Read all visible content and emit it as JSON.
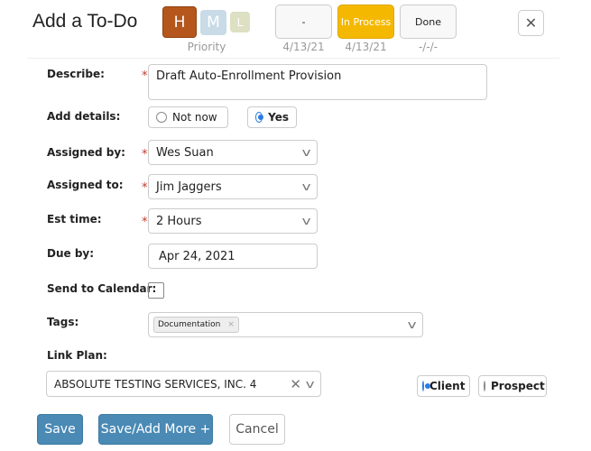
{
  "header": {
    "title": "Add a To-Do",
    "priority_label": "Priority",
    "priorities": [
      {
        "label": "H",
        "color": "#b5571c",
        "selected": true
      },
      {
        "label": "M",
        "color": "#c8dbe6"
      },
      {
        "label": "L",
        "color": "#dde0c2"
      }
    ],
    "statuses": [
      {
        "label": "-",
        "date": "4/13/21"
      },
      {
        "label": "In Process",
        "date": "4/13/21",
        "color": "#f5b800",
        "selected": true
      },
      {
        "label": "Done",
        "date": "-/-/-"
      }
    ],
    "close": "✕"
  },
  "form": {
    "describe": {
      "label": "Describe:",
      "value": "Draft Auto-Enrollment Provision"
    },
    "add_details": {
      "label": "Add details:",
      "options": [
        "Not now",
        "Yes"
      ],
      "selected": "Yes"
    },
    "assigned_by": {
      "label": "Assigned by:",
      "value": "Wes Suan"
    },
    "assigned_to": {
      "label": "Assigned to:",
      "value": "Jim Jaggers"
    },
    "est_time": {
      "label": "Est time:",
      "value": "2 Hours"
    },
    "due_by": {
      "label": "Due by:",
      "value": "Apr 24, 2021"
    },
    "send_to_calendar": {
      "label": "Send to Calendar:",
      "checked": false
    },
    "tags": {
      "label": "Tags:",
      "values": [
        "Documentation"
      ]
    },
    "link_plan": {
      "label": "Link Plan:",
      "value": "ABSOLUTE TESTING SERVICES, INC. 4",
      "options": [
        "Client",
        "Prospect"
      ],
      "selected": "Client"
    }
  },
  "actions": {
    "save": "Save",
    "save_add": "Save/Add More +",
    "cancel": "Cancel"
  }
}
